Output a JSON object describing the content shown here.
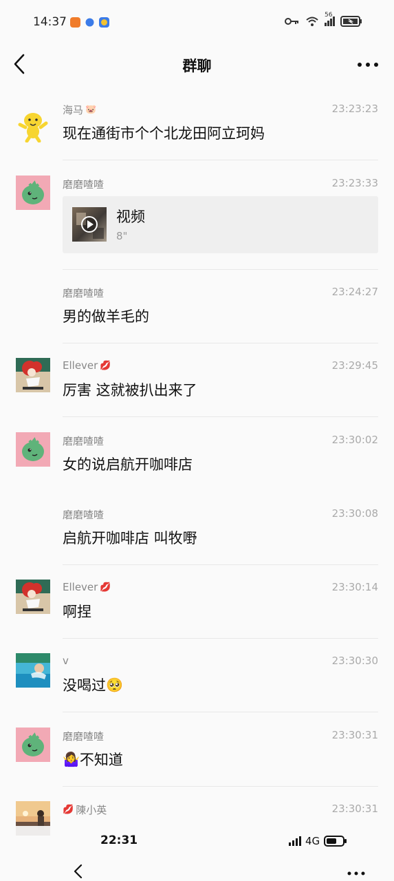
{
  "status_bar": {
    "time": "14:37",
    "network": "56",
    "colors": {
      "app1": "#f07c2a",
      "app2": "#3b7be8",
      "app3": "#f2c230"
    }
  },
  "header": {
    "title": "群聊",
    "back_icon": "chevron-left-icon",
    "more_icon": "more-icon"
  },
  "messages": [
    {
      "sender": "海马",
      "sender_emoji_after": "🐷",
      "time": "23:23:23",
      "text": "现在通街市个个北龙田阿立珂妈",
      "avatar": "yellow-cartoon"
    },
    {
      "sender": "磨磨喳喳",
      "time": "23:23:33",
      "type": "video",
      "video_title": "视频",
      "video_duration": "8\"",
      "avatar": "green-dino"
    },
    {
      "sender": "磨磨喳喳",
      "time": "23:24:27",
      "text": "男的做羊毛的"
    },
    {
      "sender": "Ellever",
      "sender_emoji_after": "💋",
      "time": "23:29:45",
      "text": "厉害 这就被扒出来了",
      "avatar": "red-hair-girl"
    },
    {
      "sender": "磨磨喳喳",
      "time": "23:30:02",
      "text": "女的说启航开咖啡店",
      "avatar": "green-dino"
    },
    {
      "sender": "磨磨喳喳",
      "time": "23:30:08",
      "text": "启航开咖啡店 叫牧嘢"
    },
    {
      "sender": "Ellever",
      "sender_emoji_after": "💋",
      "time": "23:30:14",
      "text": "啊捏",
      "avatar": "red-hair-girl"
    },
    {
      "sender": "v",
      "time": "23:30:30",
      "text": "没喝过",
      "text_emoji_after": "🥺",
      "avatar": "pool-photo"
    },
    {
      "sender": "磨磨喳喳",
      "time": "23:30:31",
      "text": "不知道",
      "text_emoji_before": "🤷‍♀️",
      "avatar": "green-dino"
    },
    {
      "sender": "陳小英",
      "sender_emoji_before": "💋",
      "time": "23:30:31",
      "avatar": "sunset-photo"
    }
  ],
  "overlay_bar": {
    "time": "22:31",
    "network": "4G"
  }
}
